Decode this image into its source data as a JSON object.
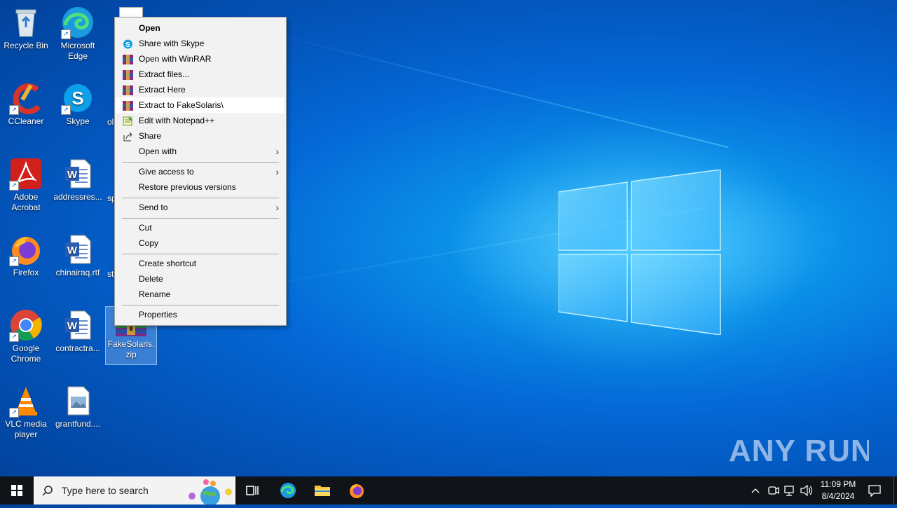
{
  "desktop": {
    "icons": [
      {
        "label": "Recycle Bin"
      },
      {
        "label": "Microsoft Edge"
      },
      {
        "label": "CCleaner"
      },
      {
        "label": "Skype"
      },
      {
        "label": "Adobe Acrobat"
      },
      {
        "label": "addressres..."
      },
      {
        "label": "Firefox"
      },
      {
        "label": "chinairaq.rtf"
      },
      {
        "label": "Google Chrome"
      },
      {
        "label": "contractra..."
      },
      {
        "label": "VLC media player"
      },
      {
        "label": "grantfund...."
      },
      {
        "label": "FakeSolaris.zip"
      }
    ],
    "partial_labels": [
      "ol",
      "sp",
      "st"
    ]
  },
  "context_menu": {
    "items": [
      {
        "label": "Open",
        "icon": "none"
      },
      {
        "label": "Share with Skype",
        "icon": "skype-icon"
      },
      {
        "label": "Open with WinRAR",
        "icon": "winrar-icon"
      },
      {
        "label": "Extract files...",
        "icon": "winrar-icon"
      },
      {
        "label": "Extract Here",
        "icon": "winrar-icon"
      },
      {
        "label": "Extract to FakeSolaris\\",
        "icon": "winrar-icon"
      },
      {
        "label": "Edit with Notepad++",
        "icon": "notepad-plus-plus-icon"
      },
      {
        "label": "Share",
        "icon": "share-icon"
      },
      {
        "label": "Open with",
        "icon": "none"
      },
      {
        "label": "Give access to",
        "icon": "none"
      },
      {
        "label": "Restore previous versions",
        "icon": "none"
      },
      {
        "label": "Send to",
        "icon": "none"
      },
      {
        "label": "Cut",
        "icon": "none"
      },
      {
        "label": "Copy",
        "icon": "none"
      },
      {
        "label": "Create shortcut",
        "icon": "none"
      },
      {
        "label": "Delete",
        "icon": "none"
      },
      {
        "label": "Rename",
        "icon": "none"
      },
      {
        "label": "Properties",
        "icon": "none"
      }
    ],
    "highlighted": "Extract to FakeSolaris\\"
  },
  "taskbar": {
    "search_placeholder": "Type here to search",
    "time": "11:09 PM",
    "date": "8/4/2024"
  },
  "watermark": "ANY RUN",
  "colors": {
    "desktop_accent": "#0a8fe8",
    "taskbar": "#101418",
    "menu_bg": "#f2f2f2"
  }
}
